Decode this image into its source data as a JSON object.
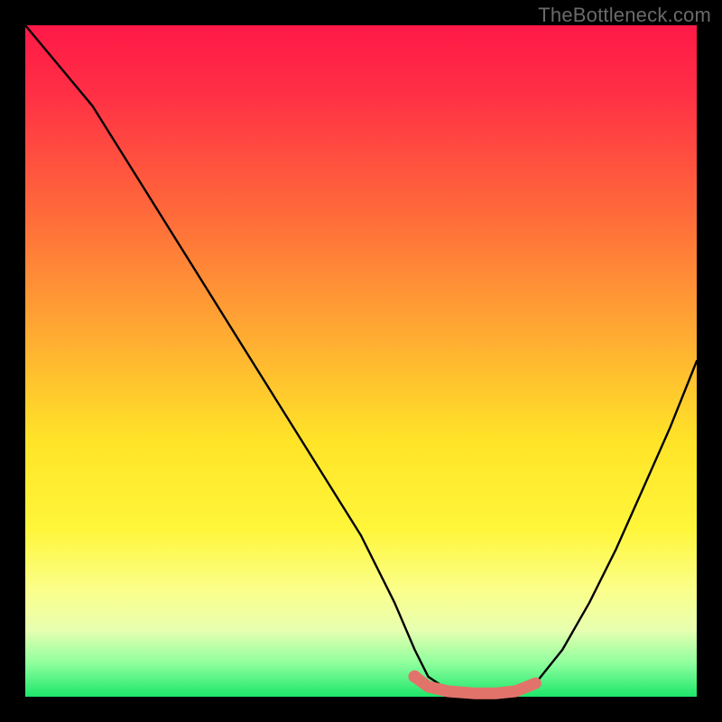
{
  "watermark": "TheBottleneck.com",
  "chart_data": {
    "type": "line",
    "title": "",
    "xlabel": "",
    "ylabel": "",
    "xlim": [
      0,
      100
    ],
    "ylim": [
      0,
      100
    ],
    "series": [
      {
        "name": "bottleneck-curve",
        "x": [
          0,
          5,
          10,
          15,
          20,
          25,
          30,
          35,
          40,
          45,
          50,
          55,
          58,
          60,
          63,
          67,
          70,
          73,
          76,
          80,
          84,
          88,
          92,
          96,
          100
        ],
        "y": [
          100,
          94,
          88,
          80,
          72,
          64,
          56,
          48,
          40,
          32,
          24,
          14,
          7,
          3,
          1,
          0,
          0,
          0,
          2,
          7,
          14,
          22,
          31,
          40,
          50
        ]
      }
    ],
    "highlight_segment": {
      "name": "flat-region-marker",
      "color": "#e2736b",
      "x": [
        58,
        60,
        63,
        67,
        70,
        73,
        76
      ],
      "y": [
        3,
        1.5,
        0.8,
        0.5,
        0.5,
        0.8,
        2
      ]
    },
    "background_gradient": {
      "top": "#ff1947",
      "mid": "#ffe428",
      "bottom": "#1de66a"
    }
  }
}
